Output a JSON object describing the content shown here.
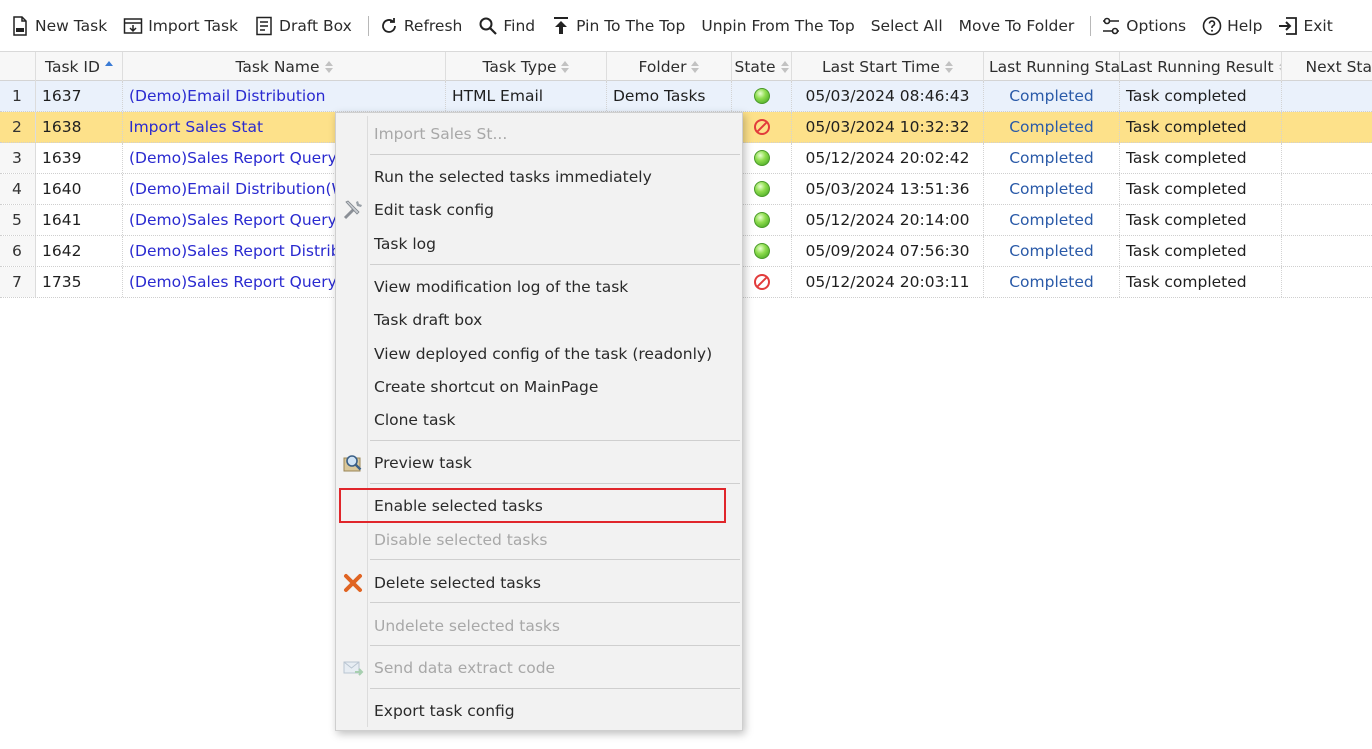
{
  "toolbar": {
    "new_task": "New Task",
    "import_task": "Import Task",
    "draft_box": "Draft Box",
    "refresh": "Refresh",
    "find": "Find",
    "pin_top": "Pin To The Top",
    "unpin_top": "Unpin From The Top",
    "select_all": "Select All",
    "move_folder": "Move To Folder",
    "options": "Options",
    "help": "Help",
    "exit": "Exit"
  },
  "table": {
    "columns": {
      "task_id": "Task ID",
      "task_name": "Task Name",
      "task_type": "Task Type",
      "folder": "Folder",
      "state": "State",
      "last_start_time": "Last Start Time",
      "last_running_status": "Last Running Stat",
      "last_running_result": "Last Running Result",
      "next_start": "Next Sta"
    },
    "rows": [
      {
        "num": "1",
        "id": "1637",
        "name": "(Demo)Email Distribution",
        "type": "HTML Email",
        "folder": "Demo Tasks",
        "state": "enabled",
        "start": "05/03/2024 08:46:43",
        "status": "Completed",
        "result": "Task completed"
      },
      {
        "num": "2",
        "id": "1638",
        "name": "Import Sales Stat",
        "type": "",
        "folder": "",
        "state": "disabled",
        "start": "05/03/2024 10:32:32",
        "status": "Completed",
        "result": "Task completed"
      },
      {
        "num": "3",
        "id": "1639",
        "name": "(Demo)Sales Report Query",
        "type": "",
        "folder": "",
        "state": "enabled",
        "start": "05/12/2024 20:02:42",
        "status": "Completed",
        "result": "Task completed"
      },
      {
        "num": "4",
        "id": "1640",
        "name": "(Demo)Email Distribution(W",
        "type": "",
        "folder": "",
        "state": "enabled",
        "start": "05/03/2024 13:51:36",
        "status": "Completed",
        "result": "Task completed"
      },
      {
        "num": "5",
        "id": "1641",
        "name": "(Demo)Sales Report Query(T",
        "type": "",
        "folder": "",
        "state": "enabled",
        "start": "05/12/2024 20:14:00",
        "status": "Completed",
        "result": "Task completed"
      },
      {
        "num": "6",
        "id": "1642",
        "name": "(Demo)Sales Report Distribu",
        "type": "",
        "folder": "",
        "state": "enabled",
        "start": "05/09/2024 07:56:30",
        "status": "Completed",
        "result": "Task completed"
      },
      {
        "num": "7",
        "id": "1735",
        "name": "(Demo)Sales Report Query(C",
        "type": "",
        "folder": "",
        "state": "disabled",
        "start": "05/12/2024 20:03:11",
        "status": "Completed",
        "result": "Task completed"
      }
    ]
  },
  "context_menu": {
    "items": [
      {
        "label": "Import Sales St...",
        "disabled": true
      },
      {
        "label": "Run the selected tasks immediately",
        "disabled": false
      },
      {
        "label": "Edit task config",
        "disabled": false,
        "icon": "wrench-screwdriver-icon"
      },
      {
        "label": "Task log",
        "disabled": false
      },
      {
        "label": "View modification log of the task",
        "disabled": false
      },
      {
        "label": "Task draft box",
        "disabled": false
      },
      {
        "label": "View deployed config of the task (readonly)",
        "disabled": false
      },
      {
        "label": "Create shortcut on MainPage",
        "disabled": false
      },
      {
        "label": "Clone task",
        "disabled": false
      },
      {
        "label": "Preview task",
        "disabled": false,
        "icon": "magnifier-preview-icon"
      },
      {
        "label": "Enable selected tasks",
        "disabled": false
      },
      {
        "label": "Disable selected tasks",
        "disabled": true
      },
      {
        "label": "Delete selected tasks",
        "disabled": false,
        "icon": "red-x-icon"
      },
      {
        "label": "Undelete selected tasks",
        "disabled": true
      },
      {
        "label": "Send data extract code",
        "disabled": true,
        "icon": "mail-send-icon"
      },
      {
        "label": "Export task config",
        "disabled": false
      }
    ]
  },
  "colors": {
    "highlight_row": "#fde18a",
    "selected_row": "#eaf1fb",
    "link": "#2a2ad0",
    "annotation_box": "#e0262b"
  }
}
